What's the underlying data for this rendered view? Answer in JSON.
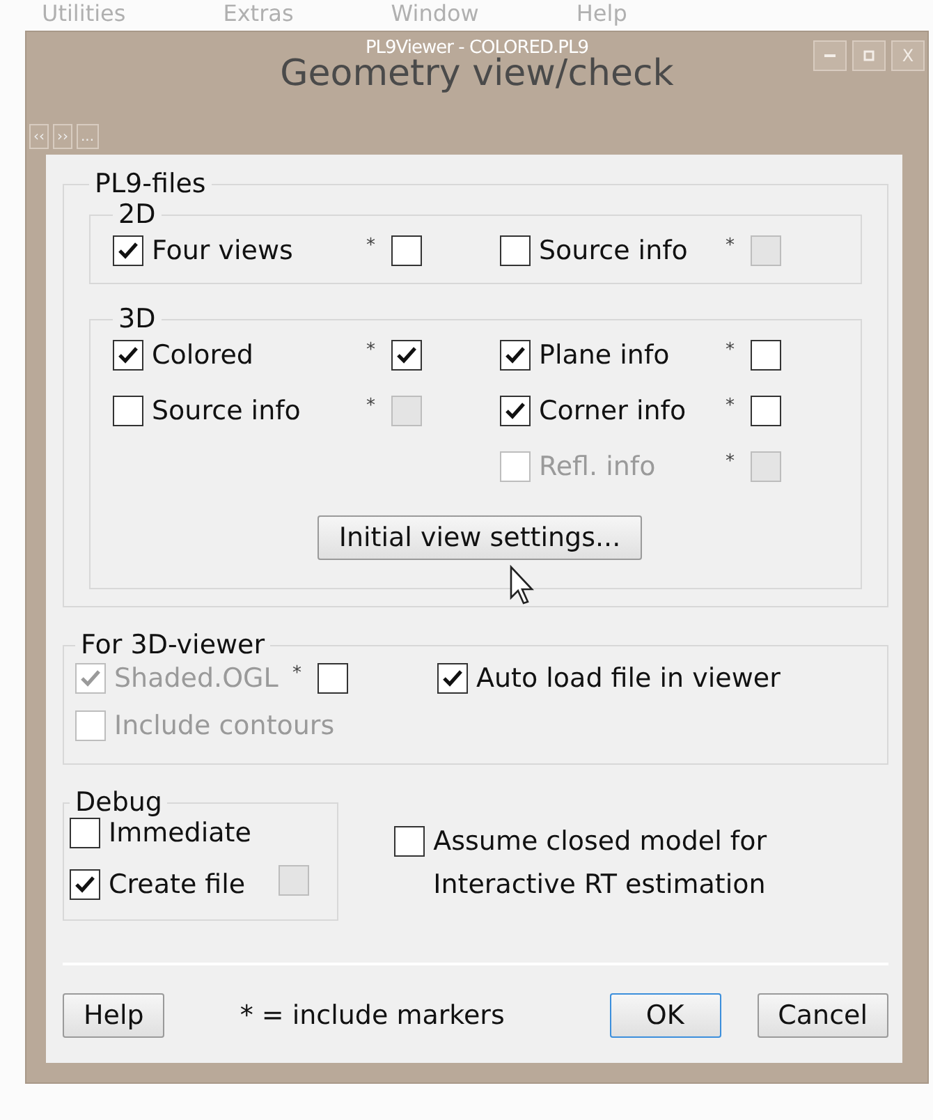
{
  "background_menu": [
    "Utilities",
    "Extras",
    "Window",
    "Help"
  ],
  "window": {
    "title": "PL9Viewer - COLORED.PL9",
    "heading": "Geometry view/check",
    "close_label": "X"
  },
  "nav_buttons": [
    "‹‹",
    "››",
    "..."
  ],
  "pl9_files": {
    "label": "PL9-files",
    "groups": [
      {
        "label": "2D",
        "rows": [
          [
            {
              "label": "Four views",
              "checked": true,
              "disabled": false,
              "marker": {
                "symbol": "*",
                "checked": false,
                "disabled": false
              }
            },
            {
              "label": "Source info",
              "checked": false,
              "disabled": false,
              "marker": {
                "symbol": "*",
                "checked": false,
                "disabled": true
              }
            }
          ]
        ]
      },
      {
        "label": "3D",
        "rows": [
          [
            {
              "label": "Colored",
              "checked": true,
              "disabled": false,
              "marker": {
                "symbol": "*",
                "checked": true,
                "disabled": false
              }
            },
            {
              "label": "Plane info",
              "checked": true,
              "disabled": false,
              "marker": {
                "symbol": "*",
                "checked": false,
                "disabled": false
              }
            }
          ],
          [
            {
              "label": "Source info",
              "checked": false,
              "disabled": false,
              "marker": {
                "symbol": "*",
                "checked": false,
                "disabled": true
              }
            },
            {
              "label": "Corner info",
              "checked": true,
              "disabled": false,
              "marker": {
                "symbol": "*",
                "checked": false,
                "disabled": false
              }
            }
          ],
          [
            null,
            {
              "label": "Refl. info",
              "checked": false,
              "disabled": true,
              "marker": {
                "symbol": "*",
                "checked": false,
                "disabled": true
              }
            }
          ]
        ],
        "button": "Initial view settings..."
      }
    ]
  },
  "viewer_3d": {
    "label": "For 3D-viewer",
    "rows": [
      [
        {
          "label": "Shaded.OGL",
          "checked": true,
          "disabled": true,
          "marker": {
            "symbol": "*",
            "checked": false,
            "disabled": false
          }
        },
        {
          "label": "Auto load file in viewer",
          "checked": true,
          "disabled": false
        }
      ],
      [
        {
          "label": "Include contours",
          "checked": false,
          "disabled": true
        },
        null
      ]
    ]
  },
  "debug": {
    "label": "Debug",
    "items": [
      {
        "label": "Immediate",
        "checked": false,
        "disabled": false
      },
      {
        "label": "Create file",
        "checked": true,
        "disabled": false,
        "extra_box": {
          "checked": false,
          "disabled": true
        }
      }
    ]
  },
  "assume_closed": {
    "label": "Assume closed model for Interactive RT estimation",
    "checked": false
  },
  "footer": {
    "help": "Help",
    "note": "* = include markers",
    "ok": "OK",
    "cancel": "Cancel"
  }
}
